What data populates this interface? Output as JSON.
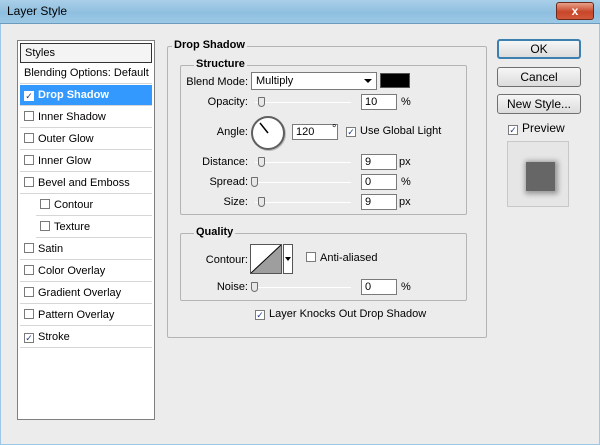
{
  "window": {
    "title": "Layer Style",
    "close_glyph": "x"
  },
  "styles_list": {
    "header": "Styles",
    "blending": "Blending Options: Default",
    "items": [
      {
        "label": "Drop Shadow",
        "checked": true,
        "selected": true
      },
      {
        "label": "Inner Shadow",
        "checked": false
      },
      {
        "label": "Outer Glow",
        "checked": false
      },
      {
        "label": "Inner Glow",
        "checked": false
      },
      {
        "label": "Bevel and Emboss",
        "checked": false
      },
      {
        "label": "Contour",
        "checked": false,
        "sub": true
      },
      {
        "label": "Texture",
        "checked": false,
        "sub": true
      },
      {
        "label": "Satin",
        "checked": false
      },
      {
        "label": "Color Overlay",
        "checked": false
      },
      {
        "label": "Gradient Overlay",
        "checked": false
      },
      {
        "label": "Pattern Overlay",
        "checked": false
      },
      {
        "label": "Stroke",
        "checked": true
      }
    ]
  },
  "drop_shadow": {
    "title": "Drop Shadow",
    "structure": {
      "title": "Structure",
      "blend_mode_label": "Blend Mode:",
      "blend_mode_value": "Multiply",
      "shadow_color": "#000000",
      "opacity_label": "Opacity:",
      "opacity_value": "10",
      "opacity_unit": "%",
      "angle_label": "Angle:",
      "angle_value": "120",
      "angle_unit": "°",
      "use_global_light_label": "Use Global Light",
      "use_global_light": true,
      "distance_label": "Distance:",
      "distance_value": "9",
      "distance_unit": "px",
      "spread_label": "Spread:",
      "spread_value": "0",
      "spread_unit": "%",
      "size_label": "Size:",
      "size_value": "9",
      "size_unit": "px"
    },
    "quality": {
      "title": "Quality",
      "contour_label": "Contour:",
      "anti_aliased_label": "Anti-aliased",
      "anti_aliased": false,
      "noise_label": "Noise:",
      "noise_value": "0",
      "noise_unit": "%"
    },
    "knockout_label": "Layer Knocks Out Drop Shadow",
    "knockout": true
  },
  "buttons": {
    "ok": "OK",
    "cancel": "Cancel",
    "new_style": "New Style...",
    "preview_label": "Preview",
    "preview": true
  },
  "check_glyph": "✓"
}
